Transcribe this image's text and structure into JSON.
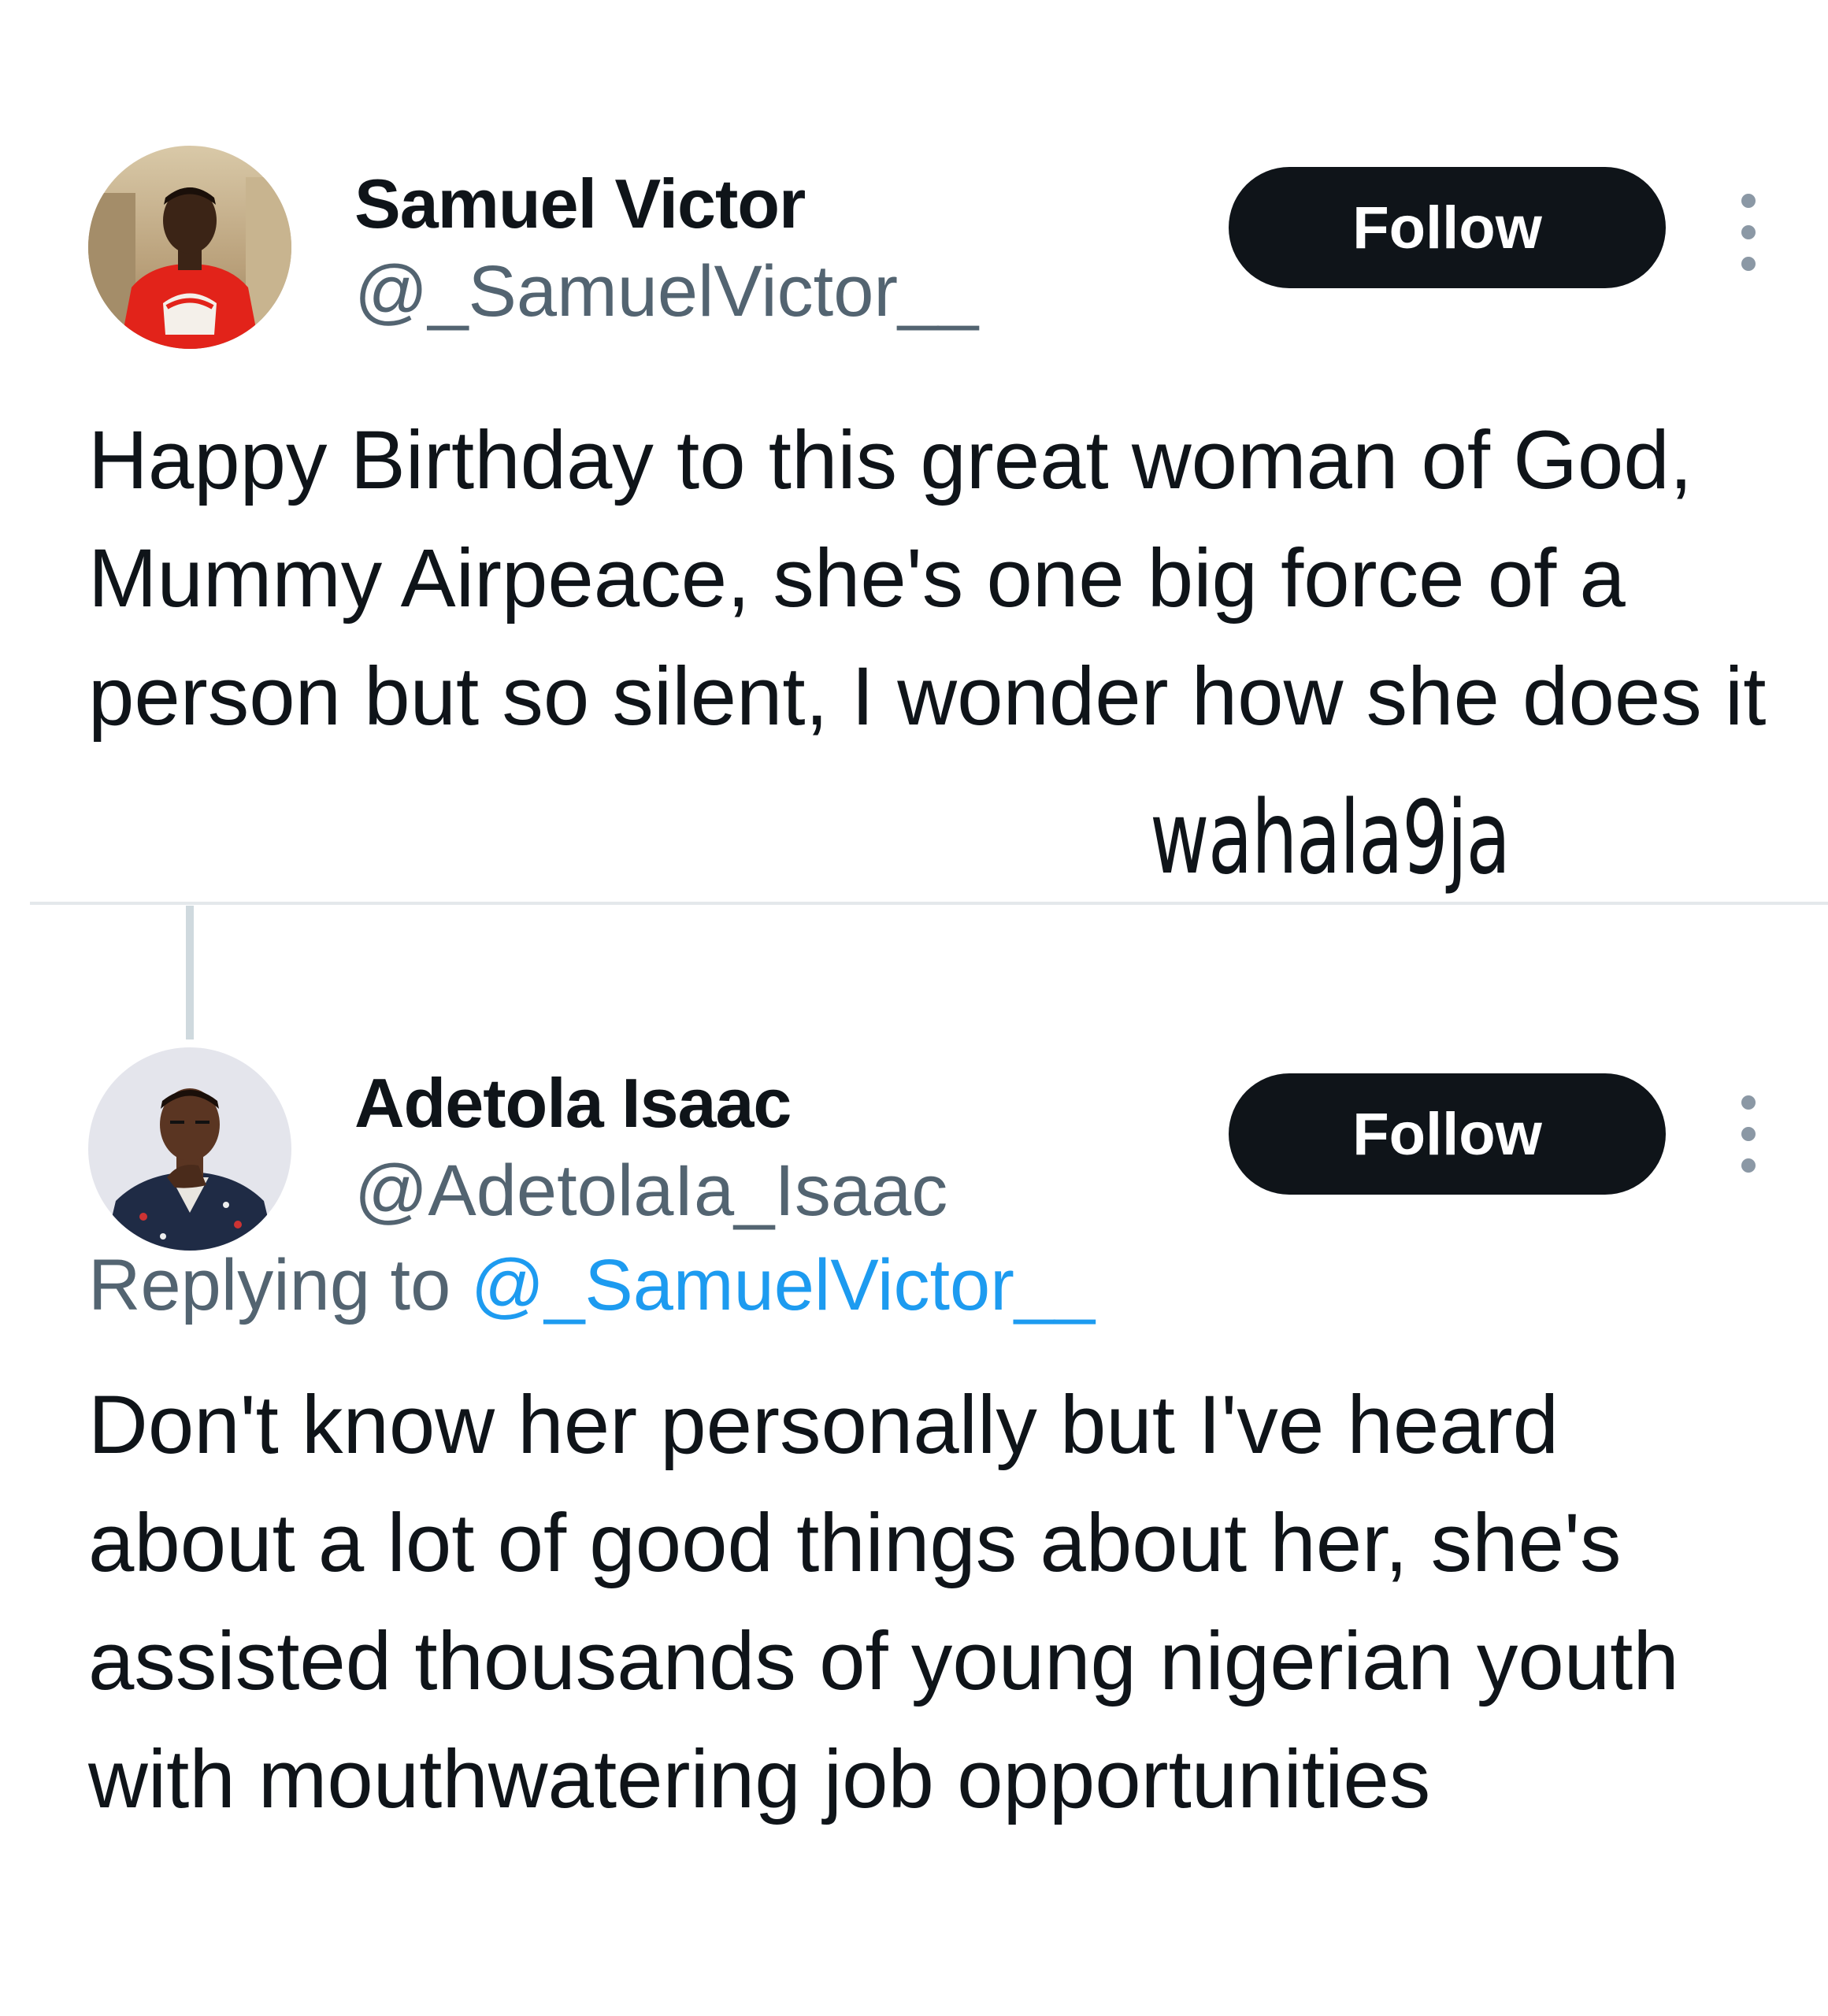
{
  "tweets": [
    {
      "author_name": "Samuel Victor",
      "author_handle": "@_SamuelVictor__",
      "follow_label": "Follow",
      "text": "Happy Birthday to this great woman of God, Mummy Airpeace, she's one big force of a person but so silent, I wonder how she does it"
    },
    {
      "author_name": "Adetola Isaac",
      "author_handle": "@AdetolaIa_Isaac",
      "follow_label": "Follow",
      "replying_prefix": "Replying to",
      "replying_handle": "@_SamuelVictor__",
      "text": "Don't know her personally but I've heard about a lot of good things about her, she's assisted thousands of young nigerian youth with mouthwatering job opportunities"
    }
  ],
  "watermark": "wahala9ja",
  "icons": {
    "more": "more-vertical-icon",
    "avatar": "avatar"
  },
  "colors": {
    "text": "#0f1419",
    "secondary": "#536471",
    "link": "#1d9bf0",
    "button_bg": "#0f1419",
    "button_text": "#ffffff"
  }
}
